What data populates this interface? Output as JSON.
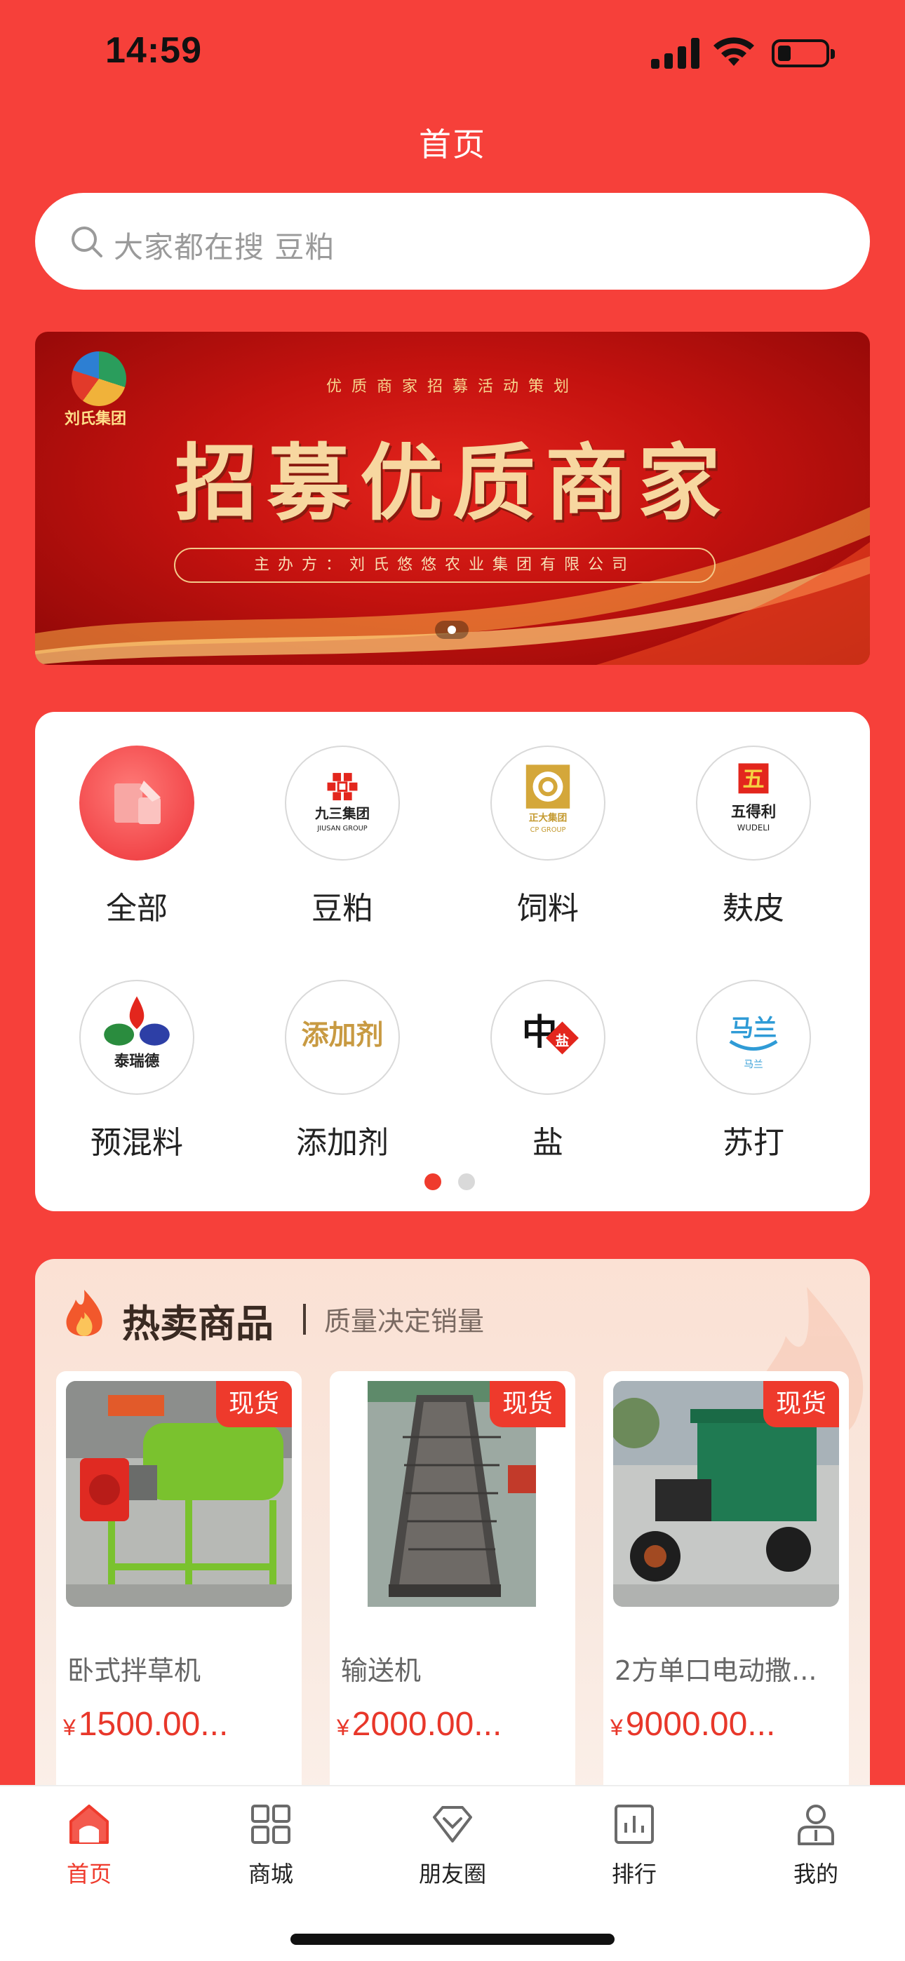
{
  "status_bar": {
    "time": "14:59"
  },
  "page_title": "首页",
  "search": {
    "placeholder": "大家都在搜 豆粕"
  },
  "banner": {
    "logo_text": "刘氏集团",
    "kicker": "优质商家招募活动策划",
    "headline": "招募优质商家",
    "host": "主办方：刘氏悠悠农业集团有限公司",
    "current_slide": 1,
    "total_slides": 1
  },
  "categories": {
    "items": [
      {
        "label": "全部",
        "icon": "all-category-icon"
      },
      {
        "label": "豆粕",
        "icon": "jiusan-group-logo",
        "logo_text": "九三集团",
        "logo_sub": "JIUSAN GROUP"
      },
      {
        "label": "饲料",
        "icon": "cp-group-logo",
        "logo_text": "正大集团",
        "logo_sub": "CP GROUP"
      },
      {
        "label": "麸皮",
        "icon": "wudeli-logo",
        "logo_text": "五得利",
        "logo_sub": "WUDELI"
      },
      {
        "label": "预混料",
        "icon": "tairuide-logo",
        "logo_text": "泰瑞德"
      },
      {
        "label": "添加剂",
        "icon": "additive-logo",
        "logo_text": "添加剂"
      },
      {
        "label": "盐",
        "icon": "china-salt-logo",
        "logo_text": "中盐"
      },
      {
        "label": "苏打",
        "icon": "malan-logo",
        "logo_text": "马兰",
        "logo_sub": "马兰"
      }
    ],
    "page_count": 2,
    "current_page": 1
  },
  "hot_section": {
    "title": "热卖商品",
    "subtitle": "质量决定销量",
    "products": [
      {
        "name": "卧式拌草机",
        "badge": "现货",
        "currency": "¥",
        "price": "1500.00...",
        "image": "green-horizontal-mixer-photo"
      },
      {
        "name": "输送机",
        "badge": "现货",
        "currency": "¥",
        "price": "2000.00...",
        "image": "belt-conveyor-photo"
      },
      {
        "name": "2方单口电动撒...",
        "badge": "现货",
        "currency": "¥",
        "price": "9000.00...",
        "image": "electric-spreader-tricycle-photo"
      }
    ]
  },
  "tab_bar": {
    "items": [
      {
        "label": "首页",
        "icon": "home-icon",
        "active": true
      },
      {
        "label": "商城",
        "icon": "grid-icon",
        "active": false
      },
      {
        "label": "朋友圈",
        "icon": "diamond-icon",
        "active": false
      },
      {
        "label": "排行",
        "icon": "chart-icon",
        "active": false
      },
      {
        "label": "我的",
        "icon": "user-icon",
        "active": false
      }
    ]
  },
  "colors": {
    "primary_red": "#f6403a",
    "accent_red": "#ef3b2d",
    "price_red": "#e8372a"
  }
}
